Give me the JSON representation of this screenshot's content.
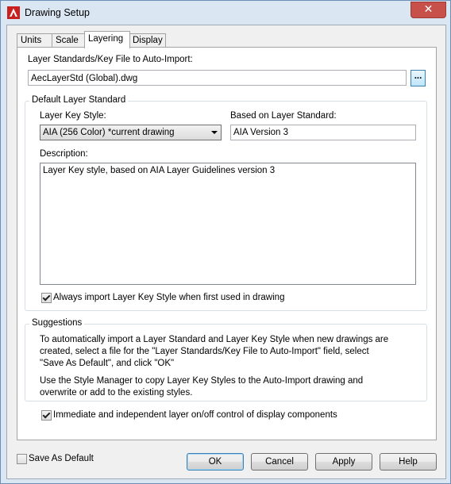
{
  "window": {
    "title": "Drawing Setup",
    "close_symbol": "✕"
  },
  "tabs": [
    {
      "label": "Units"
    },
    {
      "label": "Scale"
    },
    {
      "label": "Layering"
    },
    {
      "label": "Display"
    }
  ],
  "layer_standards": {
    "label": "Layer Standards/Key File to Auto-Import:",
    "value": "AecLayerStd (Global).dwg",
    "browse_label": "..."
  },
  "default_layer_standard": {
    "title": "Default Layer Standard",
    "key_style_label": "Layer Key Style:",
    "key_style_value": "AIA (256 Color) *current drawing",
    "based_on_label": "Based on Layer Standard:",
    "based_on_value": "AIA Version 3",
    "description_label": "Description:",
    "description_value": "Layer Key style, based on AIA Layer Guidelines version 3",
    "always_import_label": "Always import Layer Key Style when first used in drawing",
    "always_import_checked": true
  },
  "suggestions": {
    "title": "Suggestions",
    "para1": "To automatically import a Layer Standard and Layer Key Style when new drawings are created, select a file for the \"Layer Standards/Key File to Auto-Import\" field, select \"Save As Default\", and click \"OK\"",
    "para2": "Use the Style Manager to copy Layer Key Styles to the Auto-Import drawing and overwrite or add to the existing styles."
  },
  "immediate_control": {
    "label": "Immediate and independent layer on/off control of display components",
    "checked": true
  },
  "footer": {
    "save_default_label": "Save As Default",
    "save_default_checked": false,
    "ok_label": "OK",
    "cancel_label": "Cancel",
    "apply_label": "Apply",
    "help_label": "Help"
  },
  "colors": {
    "accent": "#3c7fb1",
    "close": "#c7504a",
    "app_icon": "#c8201e"
  }
}
